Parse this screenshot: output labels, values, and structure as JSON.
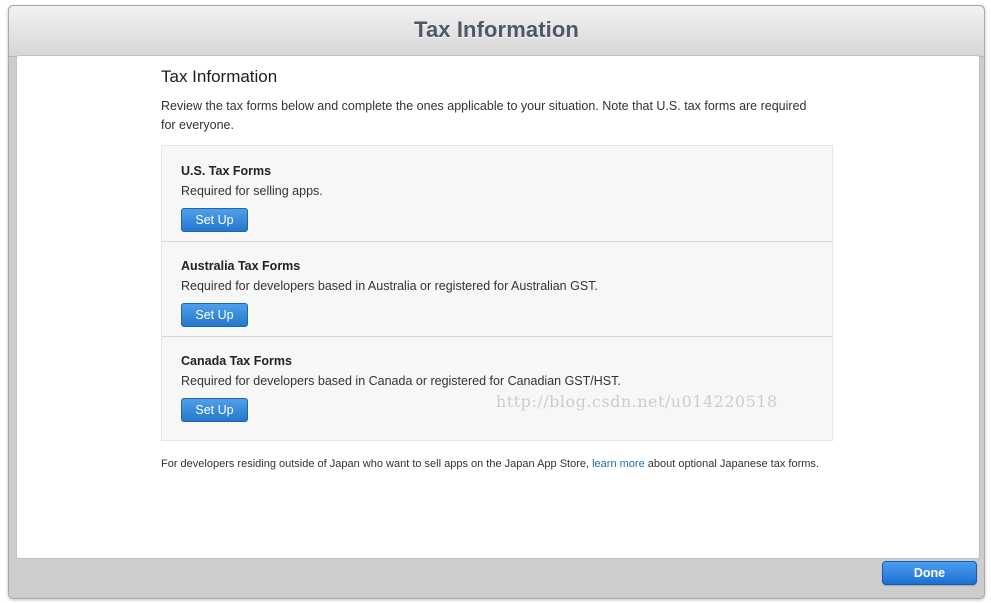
{
  "window": {
    "title": "Tax Information"
  },
  "content": {
    "heading": "Tax Information",
    "intro": "Review the tax forms below and complete the ones applicable to your situation. Note that U.S. tax forms are required for everyone.",
    "forms": [
      {
        "title": "U.S. Tax Forms",
        "description": "Required for selling apps.",
        "button_label": "Set Up"
      },
      {
        "title": "Australia Tax Forms",
        "description": "Required for developers based in Australia or registered for Australian GST.",
        "button_label": "Set Up"
      },
      {
        "title": "Canada Tax Forms",
        "description": "Required for developers based in Canada or registered for Canadian GST/HST.",
        "button_label": "Set Up"
      }
    ],
    "footer": {
      "before_link": "For developers residing outside of Japan who want to sell apps on the Japan App Store, ",
      "link_text": "learn more",
      "after_link": " about optional Japanese tax forms."
    },
    "watermark": "http://blog.csdn.net/u014220518"
  },
  "actions": {
    "done_label": "Done"
  },
  "colors": {
    "accent": "#2478cd",
    "link": "#1a6fb5",
    "title_text": "#4e5965"
  }
}
